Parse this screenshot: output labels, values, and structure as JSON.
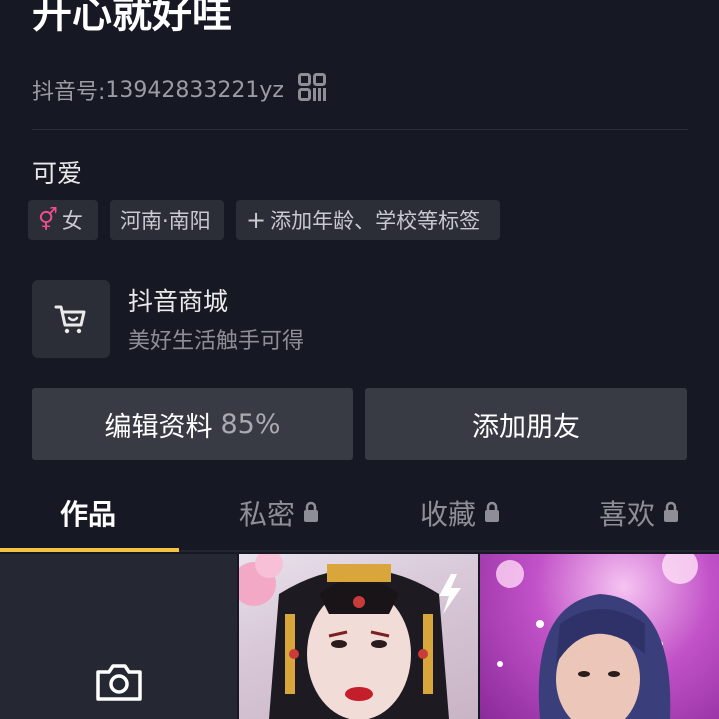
{
  "profile": {
    "nickname": "开心就好哇",
    "douyin_id_label": "抖音号:",
    "douyin_id": "13942833221yz",
    "bio": "可爱"
  },
  "tags": {
    "gender_symbol": "⚥",
    "gender": "女",
    "location": "河南·南阳",
    "add_plus": "+",
    "add_label": "添加年龄、学校等标签"
  },
  "shop": {
    "title": "抖音商城",
    "subtitle": "美好生活触手可得"
  },
  "actions": {
    "edit_label": "编辑资料",
    "edit_percent": "85%",
    "add_friends": "添加朋友"
  },
  "tabs": [
    {
      "label": "作品",
      "locked": false,
      "active": true
    },
    {
      "label": "私密",
      "locked": true
    },
    {
      "label": "收藏",
      "locked": true
    },
    {
      "label": "喜欢",
      "locked": true
    }
  ],
  "colors": {
    "background": "#161823",
    "tab_indicator": "#f6c244",
    "gender_symbol": "#f04e8c"
  },
  "icons": [
    "qr-code-icon",
    "cart-icon",
    "lock-icon",
    "camera-icon",
    "lightning-icon"
  ]
}
